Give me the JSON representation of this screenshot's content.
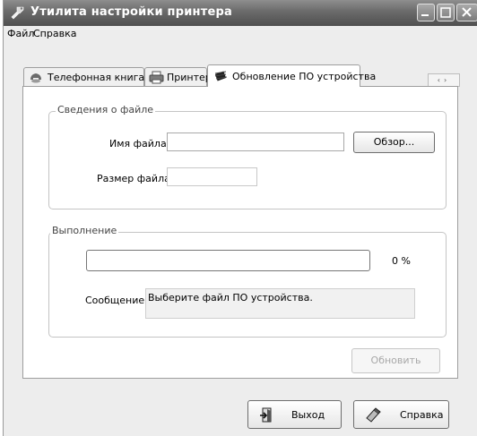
{
  "window": {
    "title": "Утилита настройки принтера"
  },
  "menu": {
    "items": [
      "Файл",
      "Справка"
    ]
  },
  "tabs": [
    {
      "label": "Телефонная книга",
      "icon": "phonebook-icon"
    },
    {
      "label": "Принтер",
      "icon": "printer-icon"
    },
    {
      "label": "Обновление ПО устройства",
      "icon": "firmware-chip-icon"
    }
  ],
  "tab_scroll": {
    "left": "‹",
    "right": "›"
  },
  "file_info": {
    "title": "Сведения о файле",
    "file_name_label": "Имя файла:",
    "file_name_value": "",
    "browse_label": "Обзор...",
    "file_size_label": "Размер файла:",
    "file_size_value": ""
  },
  "progress": {
    "title": "Выполнение",
    "percent_text": "0 %",
    "value": 0,
    "message_label": "Сообщение:",
    "message_text": "Выберите файл ПО устройства."
  },
  "update_button": {
    "label": "Обновить",
    "enabled": false
  },
  "footer": {
    "exit_label": "Выход",
    "help_label": "Справка"
  }
}
